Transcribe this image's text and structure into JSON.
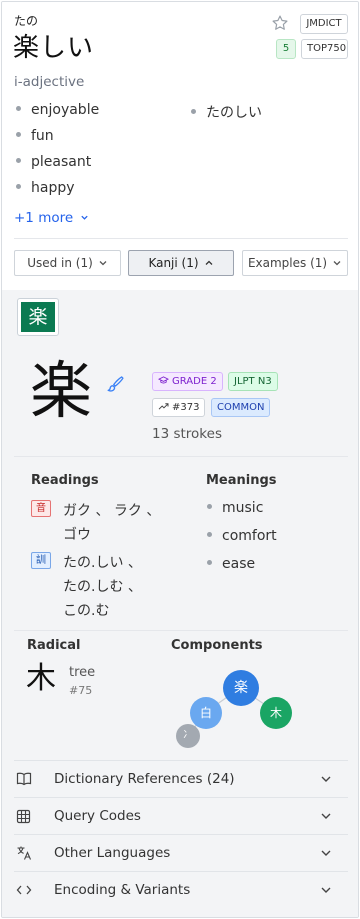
{
  "entry": {
    "furigana": "たの",
    "word": "楽しい",
    "tags": {
      "source": "JMDICT",
      "level": "5",
      "rank": "TOP750"
    },
    "part_of_speech": "i-adjective",
    "glosses": [
      "enjoyable",
      "fun",
      "pleasant",
      "happy"
    ],
    "reading": "たのしい",
    "more_label": "+1 more"
  },
  "tabs": [
    {
      "label": "Used in (1)",
      "chevron": "chevron-down-icon"
    },
    {
      "label": "Kanji (1)",
      "chevron": "chevron-up-icon"
    },
    {
      "label": "Examples (1)",
      "chevron": "chevron-down-icon"
    }
  ],
  "kanji": {
    "chip": "楽",
    "character": "楽",
    "grade": "GRADE 2",
    "jlpt": "JLPT N3",
    "freq": "#373",
    "common": "COMMON",
    "strokes": "13 strokes"
  },
  "readings": {
    "title": "Readings",
    "on_label": "音",
    "on_line1": "ガク 、 ラク 、",
    "on_line2": "ゴウ",
    "kun_label": "訓",
    "kun_line1": "たの.しい 、",
    "kun_line2": "たの.しむ 、",
    "kun_line3": "この.む"
  },
  "meanings": {
    "title": "Meanings",
    "items": [
      "music",
      "comfort",
      "ease"
    ]
  },
  "radical": {
    "title": "Radical",
    "char": "木",
    "name": "tree",
    "number": "#75"
  },
  "components": {
    "title": "Components",
    "main": "楽",
    "left": "白",
    "right": "木",
    "small": "冫"
  },
  "sections": [
    {
      "label": "Dictionary References (24)",
      "icon": "book-icon"
    },
    {
      "label": "Query Codes",
      "icon": "grid-icon"
    },
    {
      "label": "Other Languages",
      "icon": "translate-icon"
    },
    {
      "label": "Encoding & Variants",
      "icon": "code-icon"
    }
  ],
  "colors": {
    "kanji_green": "#0b7a52",
    "link_blue": "#2563eb",
    "component_blue": "#2f7de1",
    "component_light": "#6aa8f0",
    "component_green": "#1aa564",
    "component_gray": "#a3a9b1"
  }
}
